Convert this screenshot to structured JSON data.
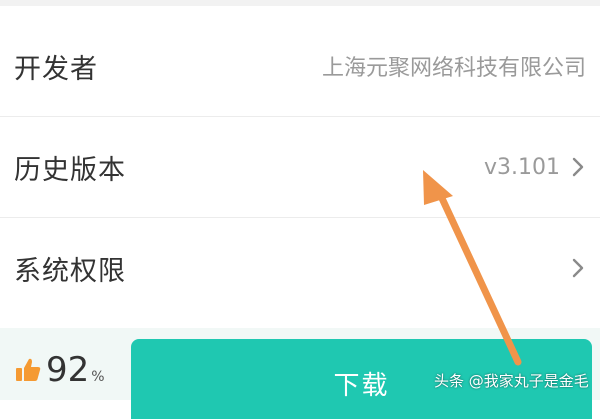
{
  "rows": [
    {
      "label": "开发者",
      "value": "上海元聚网络科技有限公司"
    },
    {
      "label": "历史版本",
      "value": "v3.101",
      "chevron": "chevron-right-icon"
    },
    {
      "label": "系统权限",
      "value": "",
      "chevron": "chevron-right-icon"
    }
  ],
  "rating": {
    "icon": "thumbs-up-icon",
    "value": "92",
    "unit": "%"
  },
  "download": {
    "label": "下载"
  },
  "annotation": {
    "icon": "arrow-icon",
    "color": "#f0944a"
  },
  "watermark": {
    "text": "头条 @我家丸子是金毛"
  },
  "colors": {
    "accent": "#1fc8b1",
    "thumb": "#f59a32",
    "bottom_bar": "#f1f8f6"
  }
}
